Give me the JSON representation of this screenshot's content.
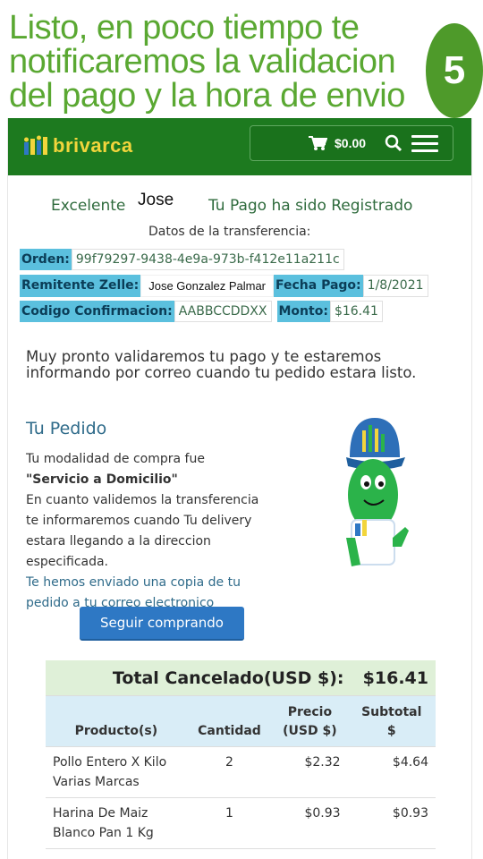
{
  "banner": {
    "lines": [
      "Listo, en poco tiempo te",
      "notificaremos la validacion",
      "del pago y la hora de envio"
    ],
    "step": "5"
  },
  "navbar": {
    "logo_text": "brivarca",
    "cart_total": "$0.00",
    "colors": {
      "bar": "#1d7a1f",
      "logo": "#f2d53c"
    }
  },
  "greeting": {
    "label": "Excelente",
    "name": "Jose",
    "status": "Tu Pago ha sido Registrado"
  },
  "transfer": {
    "title": "Datos de la transferencia:",
    "orden_label": "Orden:",
    "orden_value": "99f79297-9438-4e9a-973b-f412e11a211c",
    "remitente_label": "Remitente Zelle:",
    "remitente_value": "Jose Gonzalez Palmar",
    "fecha_label": "Fecha Pago:",
    "fecha_value": "1/8/2021",
    "codigo_label": "Codigo Confirmacion:",
    "codigo_value": "AABBCCDDXX",
    "monto_label": "Monto:",
    "monto_value": "$16.41"
  },
  "message": "Muy pronto validaremos tu pago y te estaremos informando por correo cuando tu pedido estara listo.",
  "pedido": {
    "title": "Tu Pedido",
    "line1": "Tu modalidad de compra fue",
    "mode": "\"Servicio a Domicilio\"",
    "line3": "En cuanto validemos la transferencia",
    "line4": "te informaremos cuando Tu delivery",
    "line5": "estara llegando a la direccion",
    "line6": "especificada.",
    "line7": "Te hemos enviado una copia de tu",
    "line8": "pedido a tu correo electronico"
  },
  "button": {
    "label": "Seguir comprando"
  },
  "orders": {
    "total_label": "Total Cancelado(USD $):",
    "total_value": "$16.41",
    "headers": {
      "product": "Producto(s)",
      "qty": "Cantidad",
      "price_1": "Precio",
      "price_2": "(USD $)",
      "subtotal_1": "Subtotal",
      "subtotal_2": "$"
    },
    "rows": [
      {
        "product_1": "Pollo Entero X Kilo",
        "product_2": "Varias Marcas",
        "qty": "2",
        "price": "$2.32",
        "subtotal": "$4.64"
      },
      {
        "product_1": "Harina De Maiz",
        "product_2": "Blanco Pan 1 Kg",
        "qty": "1",
        "price": "$0.93",
        "subtotal": "$0.93"
      }
    ]
  }
}
